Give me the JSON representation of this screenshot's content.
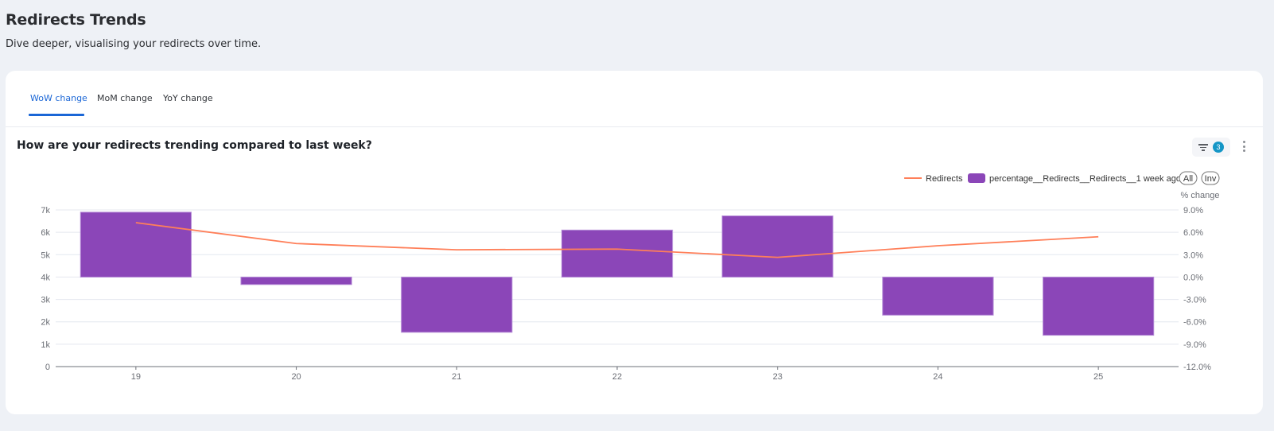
{
  "header": {
    "title": "Redirects Trends",
    "subtitle": "Dive deeper, visualising your redirects over time."
  },
  "tabs": [
    {
      "label": "WoW change",
      "active": true
    },
    {
      "label": "MoM change",
      "active": false
    },
    {
      "label": "YoY change",
      "active": false
    }
  ],
  "panel": {
    "title": "How are your redirects trending compared to last week?",
    "filter_count": "3",
    "filter_icon": "filter-icon",
    "menu_icon": "kebab-menu-icon"
  },
  "colors": {
    "accent": "#1a66d6",
    "bar": "#8b46b8",
    "line": "#ff7f59",
    "badge": "#1596c6"
  },
  "chart_data": {
    "type": "bar+line",
    "title": "How are your redirects trending compared to last week?",
    "categories": [
      "19",
      "20",
      "21",
      "22",
      "23",
      "24",
      "25"
    ],
    "series": [
      {
        "name": "Redirects",
        "type": "line",
        "axis": "left",
        "values": [
          6430,
          5500,
          5220,
          5250,
          4880,
          5400,
          5800
        ]
      },
      {
        "name": "percentage__Redirects__Redirects__1 week ago",
        "type": "bar",
        "axis": "right",
        "values": [
          8.7,
          -1.0,
          -7.4,
          6.3,
          8.2,
          -5.1,
          -7.8
        ]
      }
    ],
    "left_axis": {
      "label": "",
      "ticks": [
        "0",
        "1k",
        "2k",
        "3k",
        "4k",
        "5k",
        "6k",
        "7k"
      ],
      "range": [
        0,
        7000
      ]
    },
    "right_axis": {
      "label": "% change",
      "ticks": [
        "-12.0%",
        "-9.0%",
        "-6.0%",
        "-3.0%",
        "0.0%",
        "3.0%",
        "6.0%",
        "9.0%"
      ],
      "range": [
        -12,
        9
      ]
    },
    "xlabel": "",
    "legend": {
      "placement": "top-right",
      "buttons": [
        "All",
        "Inv"
      ]
    },
    "grid": true
  }
}
